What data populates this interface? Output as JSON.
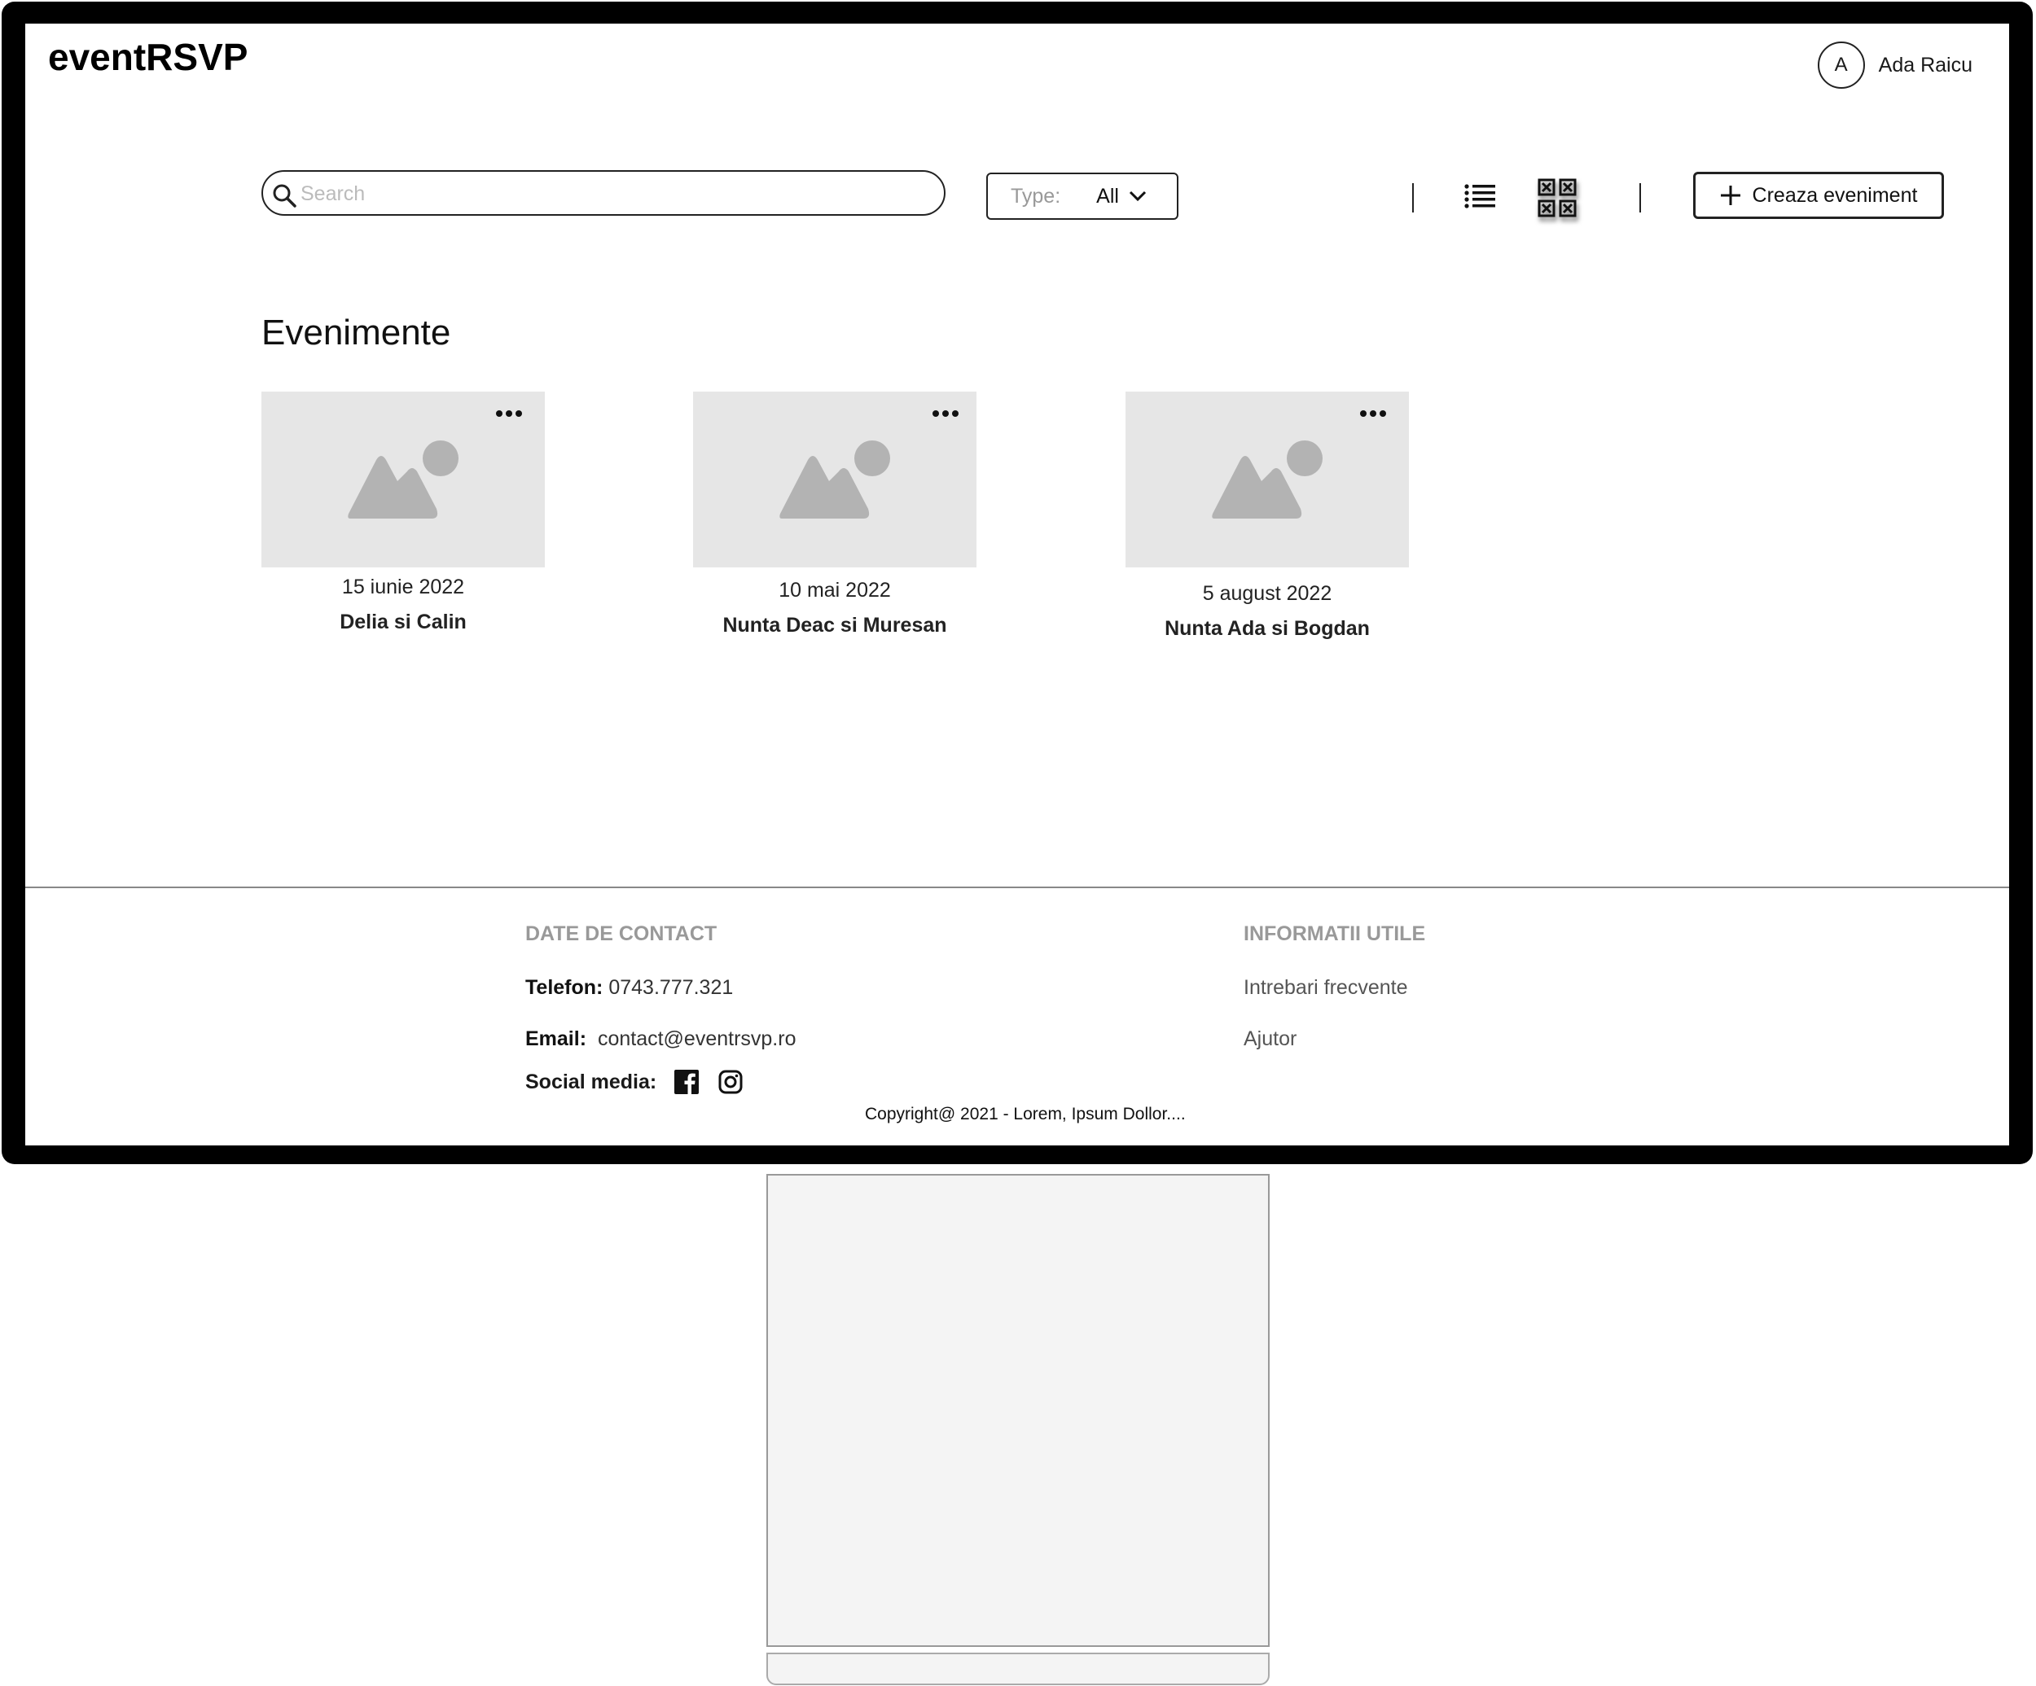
{
  "app": {
    "logo": "eventRSVP"
  },
  "user": {
    "initial": "A",
    "name": "Ada Raicu"
  },
  "toolbar": {
    "search_placeholder": "Search",
    "type_label": "Type:",
    "type_value": "All",
    "create_label": "Creaza eveniment",
    "view_modes": [
      "list",
      "grid"
    ],
    "active_view": "grid"
  },
  "main": {
    "title": "Evenimente",
    "events": [
      {
        "date": "15 iunie 2022",
        "title": "Delia si Calin"
      },
      {
        "date": "10 mai 2022",
        "title": "Nunta Deac si Muresan"
      },
      {
        "date": "5 august 2022",
        "title": "Nunta Ada si Bogdan"
      }
    ]
  },
  "footer": {
    "contact_heading": "DATE DE CONTACT",
    "phone_label": "Telefon:",
    "phone": "0743.777.321",
    "email_label": "Email:",
    "email": "contact@eventrsvp.ro",
    "social_label": "Social media:",
    "info_heading": "INFORMATII UTILE",
    "links": [
      "Intrebari frecvente",
      "Ajutor"
    ],
    "copyright": "Copyright@ 2021 - Lorem, Ipsum Dollor...."
  }
}
